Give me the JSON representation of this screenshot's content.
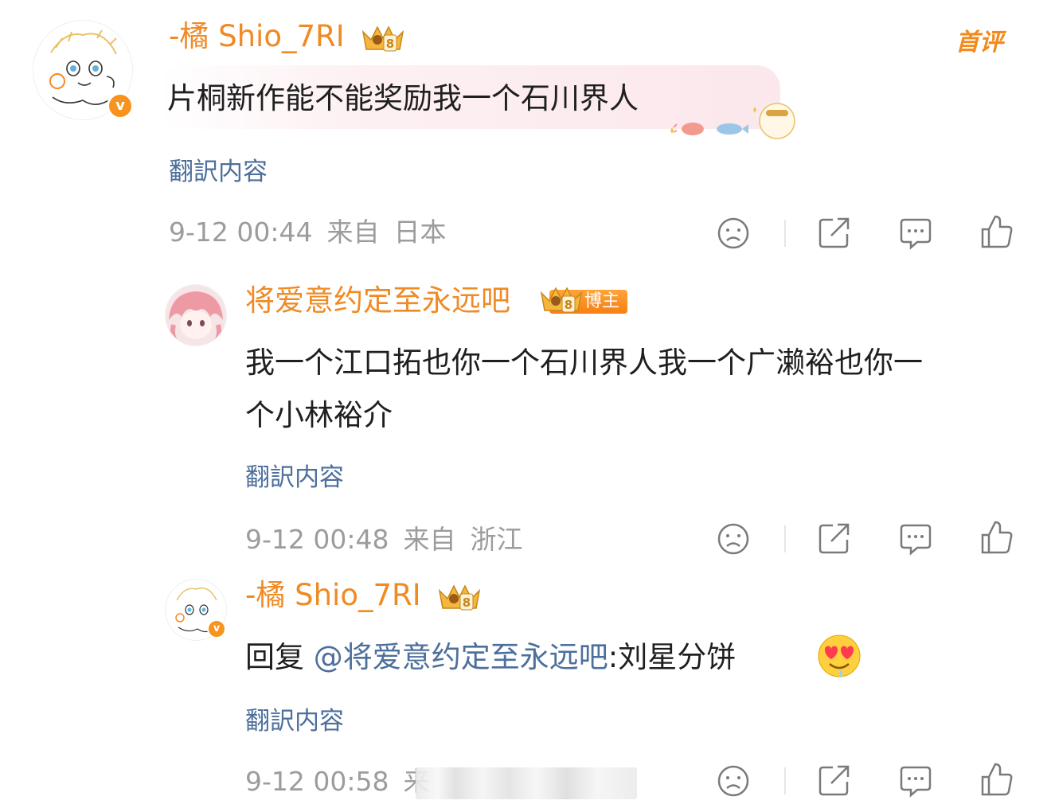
{
  "comments": [
    {
      "username": "-橘 Shio_7RI",
      "crown_level": "8",
      "first_comment_label": "首评",
      "text": "片桐新作能不能奖励我一个石川界人",
      "translate_label": "翻訳内容",
      "date": "9-12 00:44",
      "from_label": "来自",
      "location": "日本"
    },
    {
      "username": "将爱意约定至永远吧",
      "crown_level": "8",
      "role_tag": "博主",
      "text_line1": "我一个江口拓也你一个石川界人我一个广濑裕也你一",
      "text_line2": "个小林裕介",
      "translate_label": "翻訳内容",
      "date": "9-12 00:48",
      "from_label": "来自",
      "location": "浙江"
    },
    {
      "username": "-橘 Shio_7RI",
      "crown_level": "8",
      "reply_prefix": "回复 ",
      "reply_mention": "@将爱意约定至永远吧",
      "reply_text": ":刘星分饼",
      "translate_label": "翻訳内容",
      "date": "9-12 00:58",
      "from_label": "来"
    }
  ],
  "verified_badge": "v",
  "icons": {
    "dislike": "frown-face-icon",
    "share": "share-icon",
    "comment": "comment-bubble-icon",
    "like": "thumbs-up-icon",
    "emoji": "heart-eyes-emoji"
  },
  "colors": {
    "username": "#f08a24",
    "link": "#4d6f9c",
    "meta": "#9c9c9c",
    "badge": "#f7931e"
  }
}
